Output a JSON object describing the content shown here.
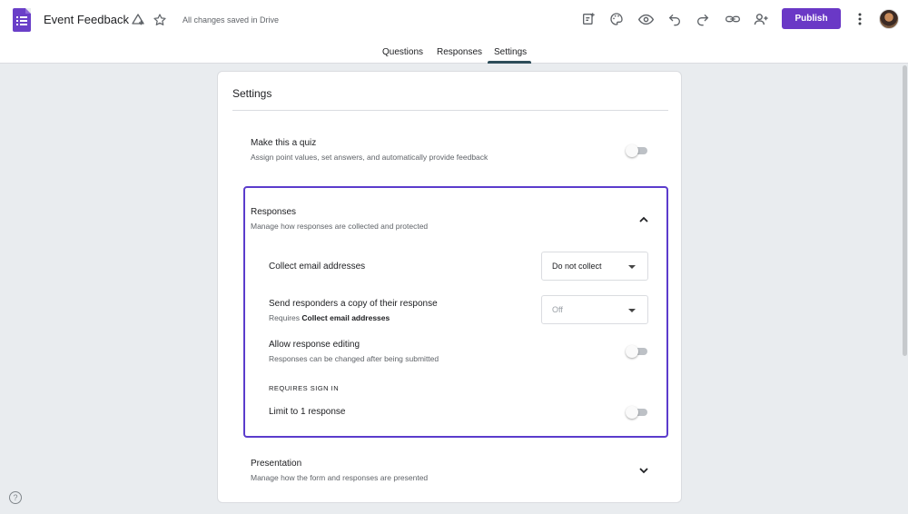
{
  "header": {
    "title": "Event Feedback",
    "save_status": "All changes saved in Drive",
    "publish_label": "Publish",
    "icons": [
      "forms-app-icon",
      "move-to-folder-icon",
      "star-icon",
      "add-collaborator-icon",
      "palette-icon",
      "preview-eye-icon",
      "undo-icon",
      "redo-icon",
      "link-icon",
      "add-person-icon",
      "more-vert-icon",
      "avatar"
    ]
  },
  "tabs": [
    {
      "label": "Questions",
      "active": false
    },
    {
      "label": "Responses",
      "active": false
    },
    {
      "label": "Settings",
      "active": true
    }
  ],
  "settings": {
    "title": "Settings",
    "quiz": {
      "label": "Make this a quiz",
      "description": "Assign point values, set answers, and automatically provide feedback",
      "enabled": false
    },
    "responses": {
      "label": "Responses",
      "description": "Manage how responses are collected and protected",
      "expanded": true,
      "collect_email": {
        "label": "Collect email addresses",
        "value": "Do not collect"
      },
      "send_copy": {
        "label": "Send responders a copy of their response",
        "desc_prefix": "Requires ",
        "desc_bold": "Collect email addresses",
        "value": "Off"
      },
      "allow_editing": {
        "label": "Allow response editing",
        "description": "Responses can be changed after being submitted",
        "enabled": false
      },
      "requires_sign_in": "REQUIRES SIGN IN",
      "limit_one": {
        "label": "Limit to 1 response",
        "enabled": false
      }
    },
    "presentation": {
      "label": "Presentation",
      "description": "Manage how the form and responses are presented",
      "expanded": false
    }
  },
  "colors": {
    "accent": "#6a38c6",
    "section_border": "#5b3ccc",
    "background": "#e9ecef"
  },
  "help_icon": "?"
}
